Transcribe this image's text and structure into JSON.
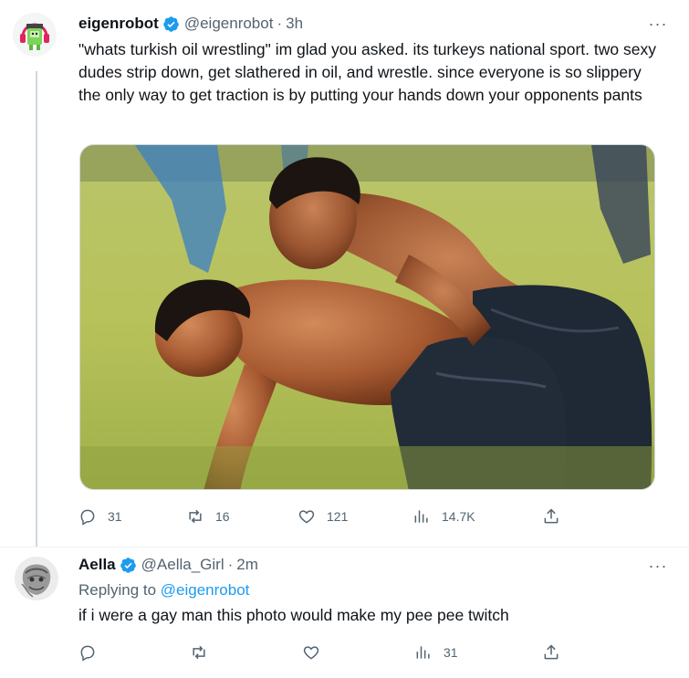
{
  "tweet": {
    "author_name": "eigenrobot",
    "handle": "@eigenrobot",
    "separator": "·",
    "time": "3h",
    "text": "\"whats turkish oil wrestling\" im glad you asked. its turkeys national sport. two sexy dudes strip down, get slathered in oil, and wrestle. since everyone is so slippery the only way to get traction is by putting your hands down your opponents pants",
    "more_label": "···",
    "media_icon": "photo-of-two-oil-wrestlers",
    "stats": {
      "replies": "31",
      "retweets": "16",
      "likes": "121",
      "views": "14.7K"
    }
  },
  "reply": {
    "author_name": "Aella",
    "handle": "@Aella_Girl",
    "separator": "·",
    "time": "2m",
    "replying_prefix": "Replying to ",
    "replying_to": "@eigenrobot",
    "text": "if i were a gay man this photo would make my pee pee twitch",
    "more_label": "···",
    "stats": {
      "views": "31"
    }
  },
  "colors": {
    "text_primary": "#0f1419",
    "text_secondary": "#536471",
    "accent": "#1d9bf0",
    "thread_line": "#cfd9de"
  }
}
